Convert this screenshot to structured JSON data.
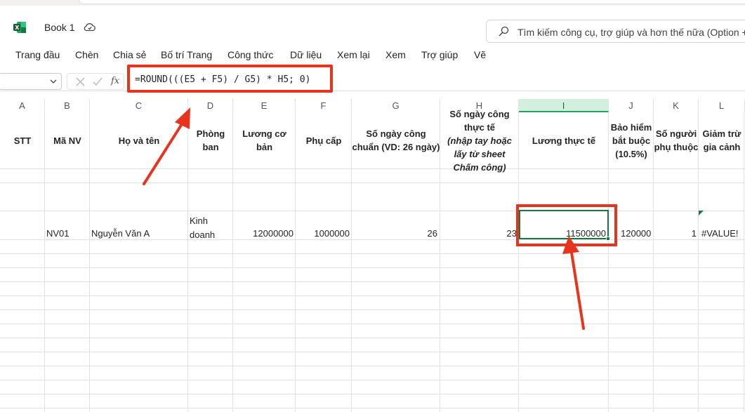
{
  "app": {
    "title": "Book 1",
    "icon": "excel-icon",
    "sync_icon": "cloud-sync-icon"
  },
  "search": {
    "placeholder": "Tìm kiếm công cụ, trợ giúp và hơn thế nữa (Option +"
  },
  "ribbon_tabs": [
    "Trang đầu",
    "Chèn",
    "Chia sẻ",
    "Bố trí Trang",
    "Công thức",
    "Dữ liệu",
    "Xem lại",
    "Xem",
    "Trợ giúp",
    "Vẽ"
  ],
  "formula_bar": {
    "name_box": "",
    "fx_label": "fx",
    "formula": "=ROUND(((E5 + F5) / G5) * H5; 0)"
  },
  "columns": [
    "A",
    "B",
    "C",
    "D",
    "E",
    "F",
    "G",
    "H",
    "I",
    "J",
    "K",
    "L"
  ],
  "selected_column": "I",
  "headers": {
    "A": "STT",
    "B": "Mã NV",
    "C": "Họ và tên",
    "D": "Phòng ban",
    "E": "Lương cơ bản",
    "F": "Phụ cấp",
    "G": "Số ngày công chuẩn (VD: 26 ngày)",
    "H_1": "Số ngày công thực tế",
    "H_2": "(nhập tay hoặc lấy từ sheet Chấm công)",
    "I": "Lương thực tế",
    "J": "Bảo hiểm bắt buộc (10.5%)",
    "K": "Số người phụ thuộc",
    "L": "Giảm trừ gia cảnh"
  },
  "row5": {
    "A": "",
    "B": "NV01",
    "C": "Nguyễn Văn A",
    "D": "Kinh doanh",
    "E": "12000000",
    "F": "1000000",
    "G": "26",
    "H": "23",
    "I": "11500000",
    "J": "120000",
    "K": "1",
    "L": "#VALUE!"
  },
  "annotation_color": "#e8341c",
  "selection_color": "#107c41"
}
